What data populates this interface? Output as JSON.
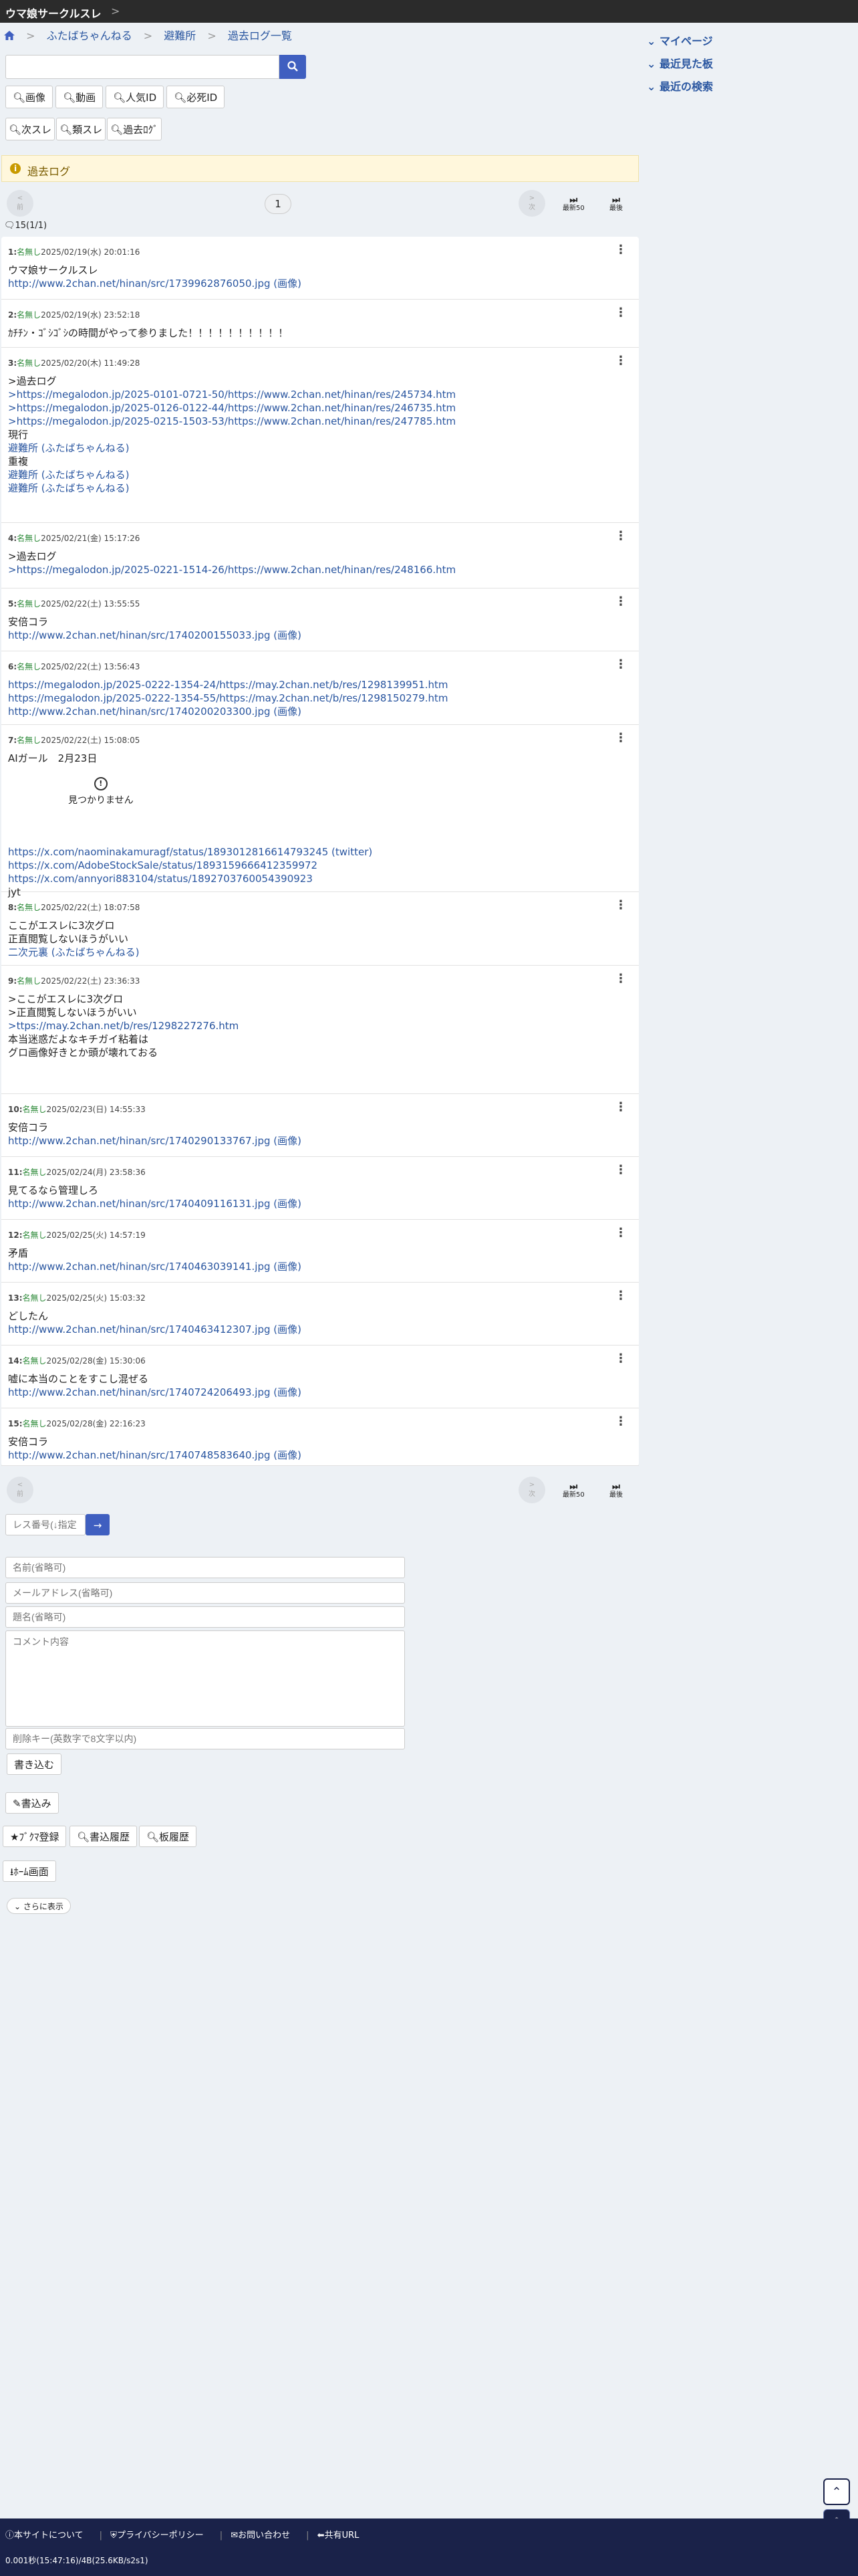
{
  "topbar": {
    "title": "ウマ娘サークルスレ",
    "chevron": ">"
  },
  "breadcrumb": [
    "ふたばちゃんねる",
    "避難所",
    "過去ログ一覧"
  ],
  "search": {
    "placeholder": ""
  },
  "buttons_row1": [
    "画像",
    "動画",
    "人気ID",
    "必死ID"
  ],
  "buttons_row2": [
    "次スレ",
    "類スレ",
    "過去ﾛｸﾞ"
  ],
  "right_sidebar": [
    "マイページ",
    "最近見た板",
    "最近の検索"
  ],
  "alert": {
    "text": "過去ログ"
  },
  "pager": {
    "prev_label": "前",
    "prev_arrow": "<",
    "page": "1",
    "next_label": "次",
    "next_arrow": ">",
    "latest50": "最新50",
    "last": "最後"
  },
  "count": "15(1/1)",
  "posts": [
    {
      "head": "1:",
      "name": "名無し",
      "date": "2025/02/19(水) 20:01:16",
      "lines": [
        "ウマ娘サークルスレ",
        "http://www.2chan.net/hinan/src/1739962876050.jpg (画像)"
      ]
    },
    {
      "head": "2:",
      "name": "名無し",
      "date": "2025/02/19(水) 23:52:18",
      "lines": [
        "ｶﾁﾁﾝ・ｺﾞｼｺﾞｼの時間がやって参りました！！！！！！！！！！"
      ]
    },
    {
      "head": "3:",
      "name": "名無し",
      "date": "2025/02/20(木) 11:49:28",
      "lines": [
        ">過去ログ",
        ">https://megalodon.jp/2025-0101-0721-50/https://www.2chan.net/hinan/res/245734.htm",
        ">https://megalodon.jp/2025-0126-0122-44/https://www.2chan.net/hinan/res/246735.htm",
        ">https://megalodon.jp/2025-0215-1503-53/https://www.2chan.net/hinan/res/247785.htm",
        "現行",
        "避難所 (ふたばちゃんねる)",
        "重複",
        "避難所 (ふたばちゃんねる)",
        "避難所 (ふたばちゃんねる)"
      ]
    },
    {
      "head": "4:",
      "name": "名無し",
      "date": "2025/02/21(金) 15:17:26",
      "lines": [
        ">過去ログ",
        ">https://megalodon.jp/2025-0221-1514-26/https://www.2chan.net/hinan/res/248166.htm"
      ]
    },
    {
      "head": "5:",
      "name": "名無し",
      "date": "2025/02/22(土) 13:55:55",
      "lines": [
        "安倍コラ",
        "http://www.2chan.net/hinan/src/1740200155033.jpg (画像)"
      ]
    },
    {
      "head": "6:",
      "name": "名無し",
      "date": "2025/02/22(土) 13:56:43",
      "lines": [
        "https://megalodon.jp/2025-0222-1354-24/https://may.2chan.net/b/res/1298139951.htm",
        "https://megalodon.jp/2025-0222-1354-55/https://may.2chan.net/b/res/1298150279.htm",
        "http://www.2chan.net/hinan/src/1740200203300.jpg (画像)"
      ]
    },
    {
      "head": "7:",
      "name": "名無し",
      "date": "2025/02/22(土) 15:08:05",
      "lines": [
        "AIガール　2月23日",
        "",
        "",
        "",
        "",
        "",
        "",
        "https://x.com/naominakamuragf/status/1893012816614793245 (twitter)",
        "https://x.com/AdobeStockSale/status/1893159666412359972",
        "https://x.com/annyori883104/status/1892703760054390923",
        "jyt"
      ],
      "notfound": "見つかりません"
    },
    {
      "head": "8:",
      "name": "名無し",
      "date": "2025/02/22(土) 18:07:58",
      "lines": [
        "ここがエスレに3次グロ",
        "正直閲覧しないほうがいい",
        "二次元裏 (ふたばちゃんねる)"
      ]
    },
    {
      "head": "9:",
      "name": "名無し",
      "date": "2025/02/22(土) 23:36:33",
      "lines": [
        ">ここがエスレに3次グロ",
        ">正直閲覧しないほうがいい",
        ">ttps://may.2chan.net/b/res/1298227276.htm",
        "本当迷惑だよなキチガイ粘着は",
        "グロ画像好きとか頭が壊れておる"
      ]
    },
    {
      "head": "10:",
      "name": "名無し",
      "date": "2025/02/23(日) 14:55:33",
      "lines": [
        "安倍コラ",
        "http://www.2chan.net/hinan/src/1740290133767.jpg (画像)"
      ]
    },
    {
      "head": "11:",
      "name": "名無し",
      "date": "2025/02/24(月) 23:58:36",
      "lines": [
        "見てるなら管理しろ",
        "http://www.2chan.net/hinan/src/1740409116131.jpg (画像)"
      ]
    },
    {
      "head": "12:",
      "name": "名無し",
      "date": "2025/02/25(火) 14:57:19",
      "lines": [
        "矛盾",
        "http://www.2chan.net/hinan/src/1740463039141.jpg (画像)"
      ]
    },
    {
      "head": "13:",
      "name": "名無し",
      "date": "2025/02/25(火) 15:03:32",
      "lines": [
        "どしたん",
        "http://www.2chan.net/hinan/src/1740463412307.jpg (画像)"
      ]
    },
    {
      "head": "14:",
      "name": "名無し",
      "date": "2025/02/28(金) 15:30:06",
      "lines": [
        "嘘に本当のことをすこし混ぜる",
        "http://www.2chan.net/hinan/src/1740724206493.jpg (画像)"
      ]
    },
    {
      "head": "15:",
      "name": "名無し",
      "date": "2025/02/28(金) 22:16:23",
      "lines": [
        "安倍コラ",
        "http://www.2chan.net/hinan/src/1740748583640.jpg (画像)"
      ]
    }
  ],
  "resnum": {
    "placeholder": "レス番号(↓指定"
  },
  "form": {
    "name_placeholder": "名前(省略可)",
    "mail_placeholder": "メールアドレス(省略可)",
    "subject_placeholder": "題名(省略可)",
    "comment_placeholder": "コメント内容",
    "delkey_placeholder": "削除キー(英数字で8文字以内)",
    "submit": "書き込む"
  },
  "actions": {
    "write": "書込み",
    "bookmark": "ﾌﾞｸﾏ登録",
    "post_history": "書込履歴",
    "board_history": "板履歴",
    "home": "ﾎｰﾑ画面",
    "more": "さらに表示"
  },
  "footer": {
    "about": "本サイトについて",
    "privacy": "プライバシーポリシー",
    "contact": "お問い合わせ",
    "share": "共有URL",
    "stats": "0.001秒(15:47:16)/4B(25.6KB/s2s1)"
  }
}
